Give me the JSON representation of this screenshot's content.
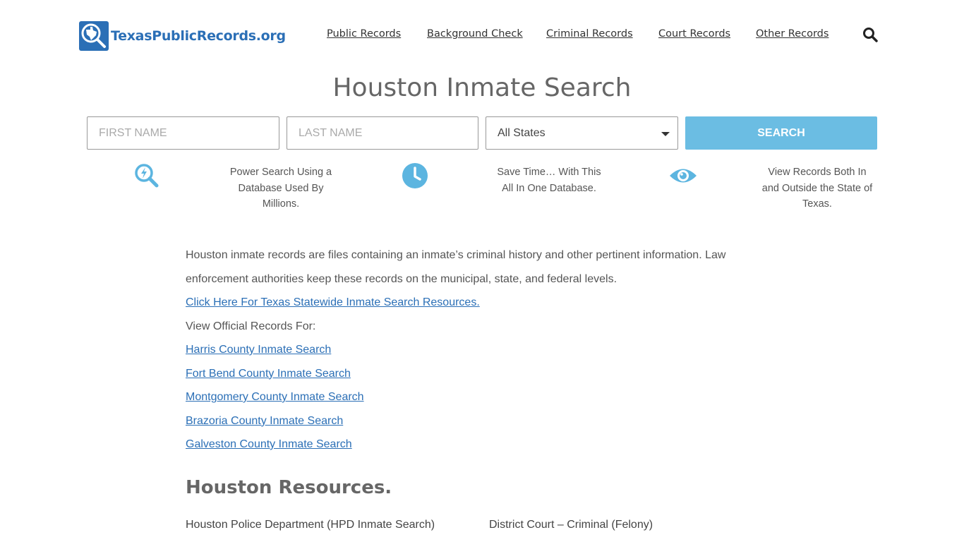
{
  "header": {
    "logo_text": "TexasPublicRecords.org",
    "nav": [
      {
        "label": "Public Records"
      },
      {
        "label": "Background Check"
      },
      {
        "label": "Criminal Records"
      },
      {
        "label": "Court Records"
      },
      {
        "label": "Other Records"
      }
    ]
  },
  "page_title": "Houston Inmate Search",
  "search_form": {
    "first_name_placeholder": "FIRST NAME",
    "last_name_placeholder": "LAST NAME",
    "state_selected": "All States",
    "button_label": "SEARCH"
  },
  "features": [
    {
      "icon": "lightning-magnifier-icon",
      "text": "Power Search Using a Database Used By Millions."
    },
    {
      "icon": "clock-icon",
      "text": "Save Time… With This All In One Database."
    },
    {
      "icon": "eye-icon",
      "text": "View Records Both In and Outside the State of Texas."
    }
  ],
  "content": {
    "intro": "Houston inmate records are files containing an inmate’s criminal history and other pertinent information. Law enforcement authorities keep these records on the municipal, state, and federal levels.",
    "statewide_link": "Click Here For Texas Statewide Inmate Search Resources.",
    "view_official": "View Official Records For:",
    "county_links": [
      "Harris County Inmate Search",
      "Fort Bend County Inmate Search",
      "Montgomery County Inmate Search",
      "Brazoria County Inmate Search",
      "Galveston County Inmate Search"
    ]
  },
  "resources": {
    "title": "Houston Resources.",
    "items": [
      "Houston Police Department (HPD Inmate Search)",
      "District Court – Criminal (Felony)"
    ]
  },
  "colors": {
    "brand_blue": "#2b6fb6",
    "button_blue": "#6bbde3",
    "icon_blue": "#5cb5e0"
  }
}
